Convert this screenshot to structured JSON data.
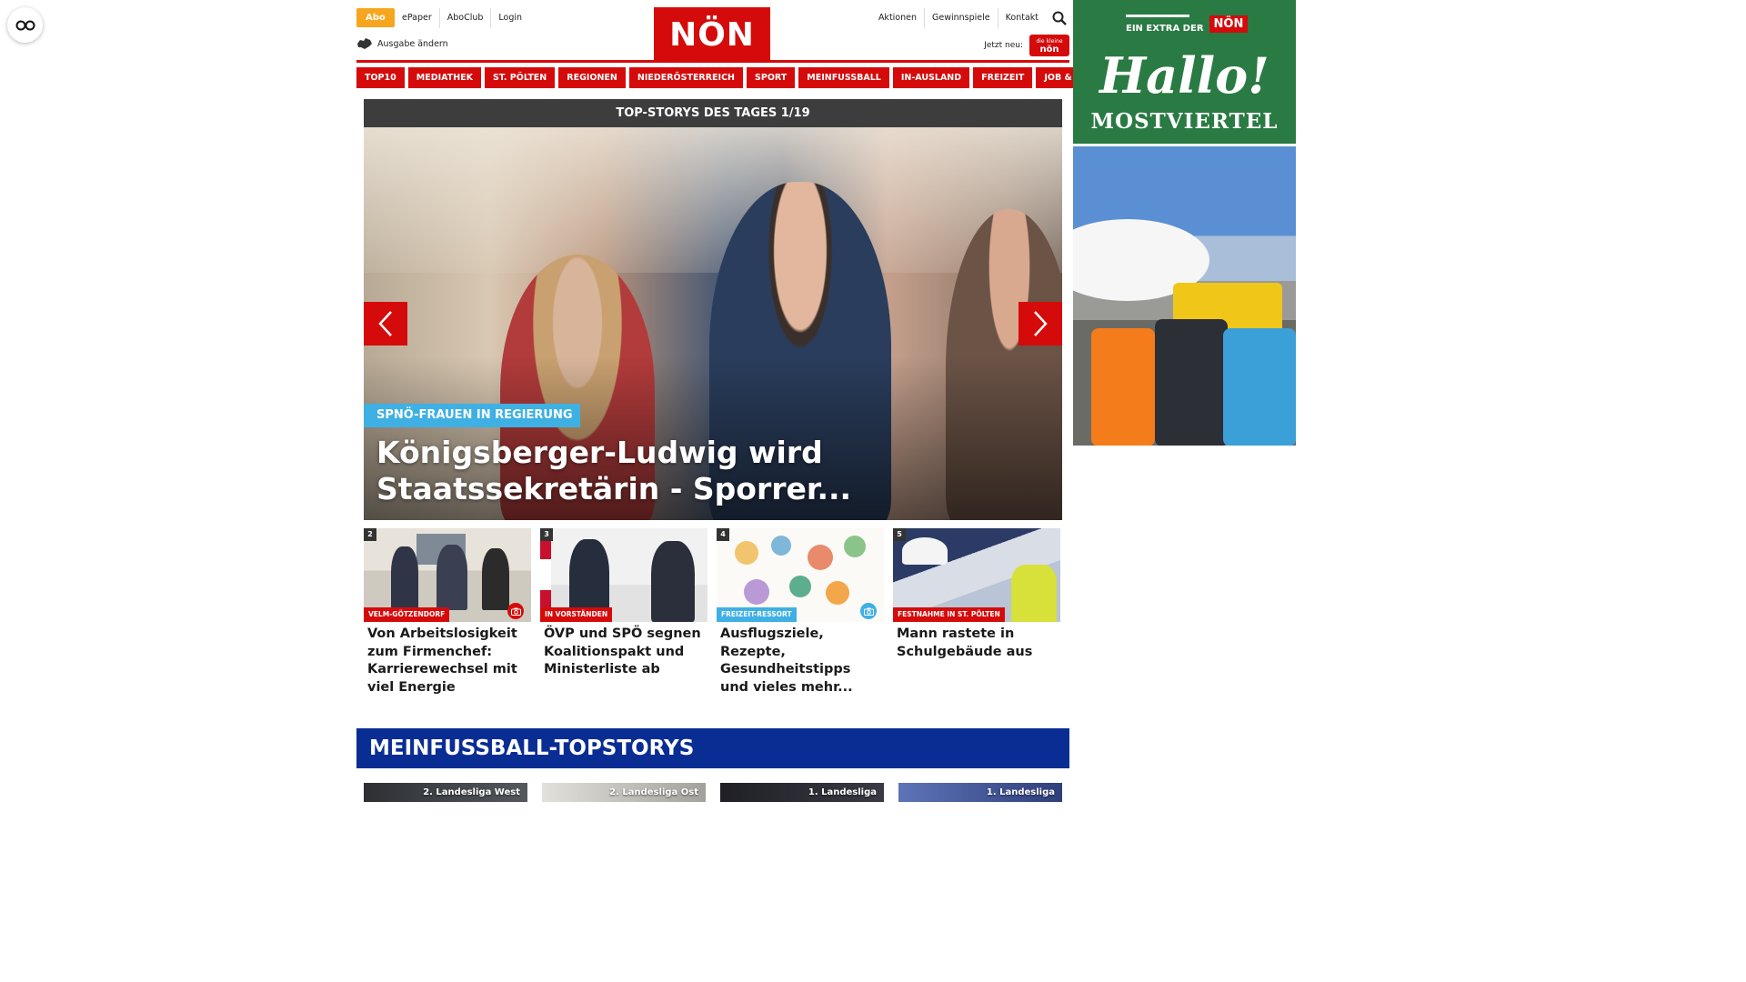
{
  "top": {
    "abo": "Abo",
    "left_links": [
      "ePaper",
      "AboClub",
      "Login"
    ],
    "right_links": [
      "Aktionen",
      "Gewinnspiele",
      "Kontakt"
    ],
    "logo": "NÖN",
    "edition": "Ausgabe ändern",
    "jetzt_neu": "Jetzt neu:",
    "jetzt_badge_small": "die kleine",
    "jetzt_badge": "nön"
  },
  "nav": [
    "TOP10",
    "MEDIATHEK",
    "ST. PÖLTEN",
    "REGIONEN",
    "NIEDERÖSTERREICH",
    "SPORT",
    "MEINFUSSBALL",
    "IN-AUSLAND",
    "FREIZEIT",
    "JOB & KARRIERE"
  ],
  "hero": {
    "bar_title": "TOP-STORYS DES TAGES 1/19",
    "kicker": "SPNÖ-FRAUEN IN REGIERUNG",
    "headline": "Königsberger-Ludwig wird Staatssekretärin - Sporrer..."
  },
  "teasers": [
    {
      "num": "2",
      "tag": "VELM-GÖTZENDORF",
      "title": "Von Arbeitslosigkeit zum Firmenchef: Karrierewechsel mit viel Energie"
    },
    {
      "num": "3",
      "tag": "IN VORSTÄNDEN",
      "title": "ÖVP und SPÖ segnen Koalitionspakt und Ministerliste ab"
    },
    {
      "num": "4",
      "tag": "FREIZEIT-RESSORT",
      "title": "Ausflugsziele, Rezepte, Gesundheitstipps und vieles mehr..."
    },
    {
      "num": "5",
      "tag": "FESTNAHME IN ST. PÖLTEN",
      "title": "Mann rastete in Schulgebäude aus"
    }
  ],
  "meinfussball": {
    "title": "MEINFUSSBALL-TOPSTORYS",
    "cards": [
      "2. Landesliga West",
      "2. Landesliga Ost",
      "1. Landesliga",
      "1. Landesliga"
    ]
  },
  "ads": {
    "extra": "EIN EXTRA DER",
    "extra_logo": "NÖN",
    "hallo": "Hallo!",
    "region": "MOSTVIERTEL"
  },
  "colors": {
    "brand_red": "#d50b0b",
    "accent_blue": "#3fb0e3",
    "fussball_blue": "#0a2d93",
    "abo_orange": "#f7a51e",
    "ad_green": "#2a7a43"
  },
  "icons": [
    "glasses-icon",
    "search-icon",
    "austria-map-icon",
    "chevron-left-icon",
    "chevron-right-icon",
    "camera-icon"
  ]
}
